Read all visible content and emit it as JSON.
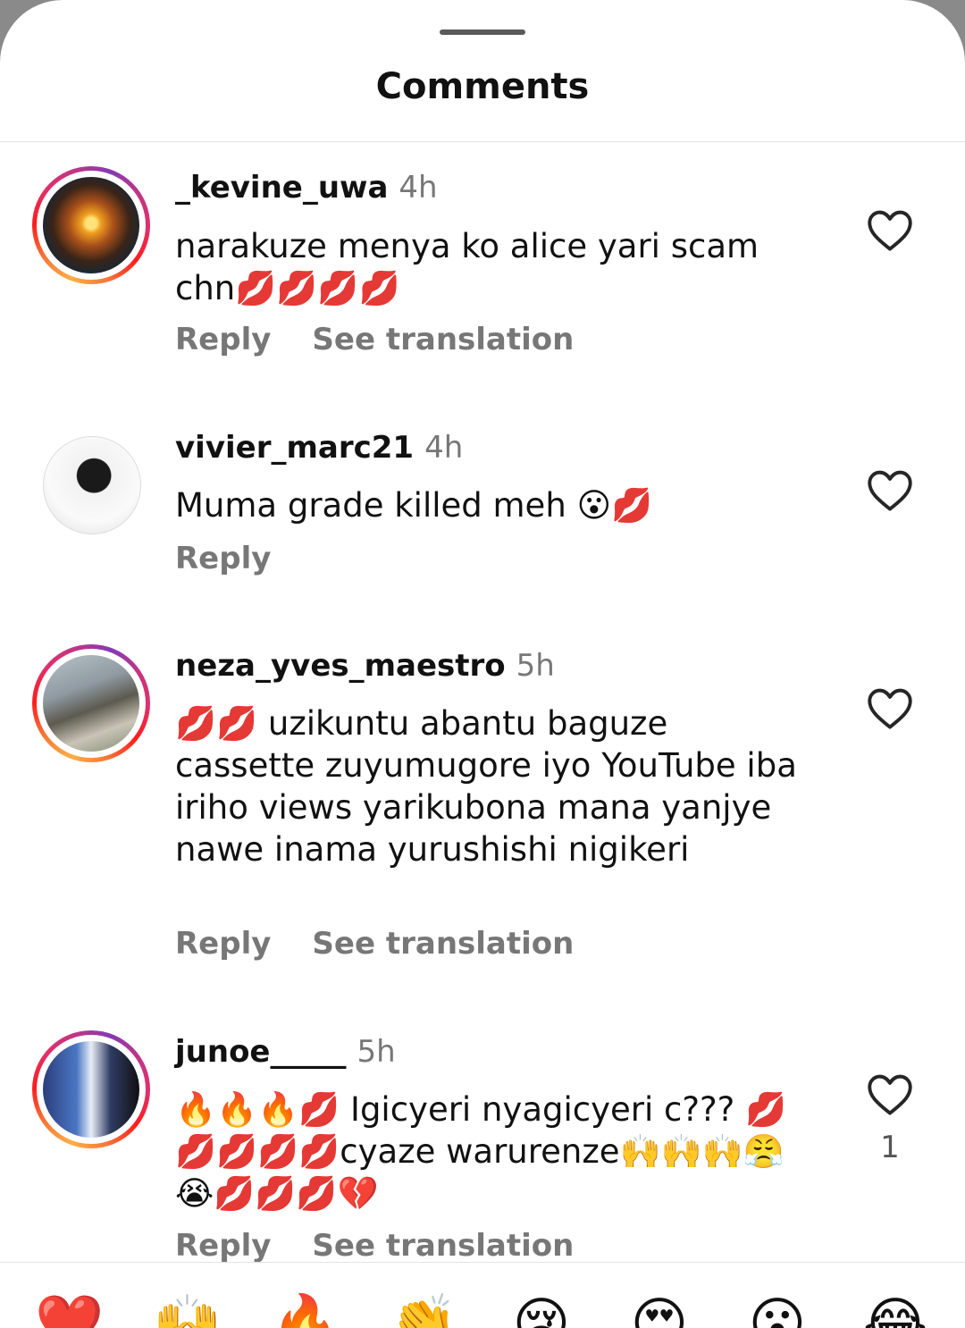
{
  "header": {
    "title": "Comments"
  },
  "comments": [
    {
      "username": "_kevine_uwa",
      "time": "4h",
      "text": "narakuze menya ko alice yari scam chn💋💋💋💋",
      "actions": [
        "Reply",
        "See translation"
      ],
      "likes": ""
    },
    {
      "username": "vivier_marc21",
      "time": "4h",
      "text": "Muma grade killed meh 😮💋",
      "actions": [
        "Reply"
      ],
      "likes": ""
    },
    {
      "username": "neza_yves_maestro",
      "time": "5h",
      "text": "💋💋 uzikuntu abantu baguze cassette zuyumugore iyo YouTube iba iriho views yarikubona mana yanjye nawe inama yurushishi nigikeri",
      "actions": [
        "Reply",
        "See translation"
      ],
      "likes": ""
    },
    {
      "username": "junoe_____",
      "time": "5h",
      "text": "🔥🔥🔥💋 Igicyeri nyagicyeri c??? 💋💋💋💋💋cyaze warurenze🙌🙌🙌😤😭💋💋💋💔",
      "actions": [
        "Reply",
        "See translation"
      ],
      "likes": "1"
    }
  ],
  "reactions": [
    "❤️",
    "🙌",
    "🔥",
    "👏",
    "😢",
    "😍",
    "😮",
    "😂"
  ],
  "icons": {
    "like": "heart-outline-icon"
  },
  "colors": {
    "ring": "#e1306c",
    "heart_outline": "#262626",
    "secondary_text": "#777777"
  }
}
